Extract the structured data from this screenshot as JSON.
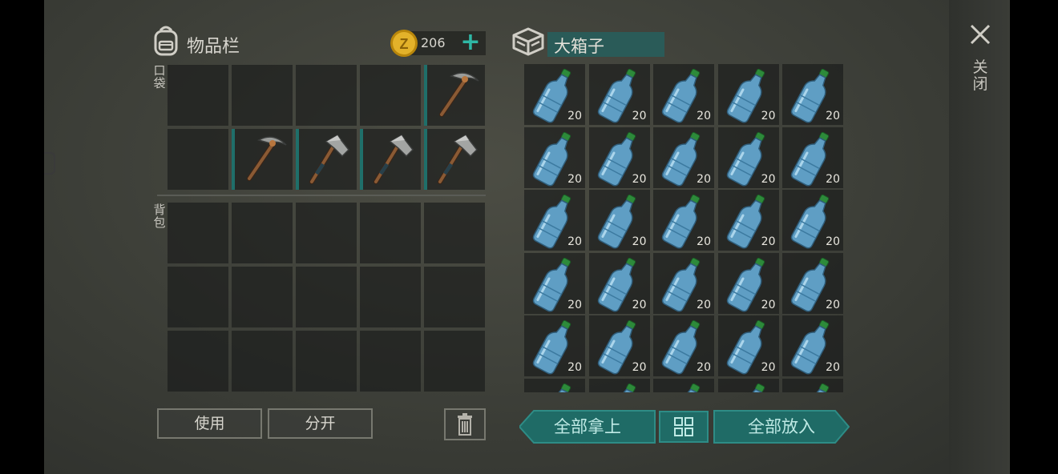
{
  "inventory": {
    "title": "物品栏",
    "coins": "206",
    "pocket_label": "口袋",
    "backpack_label": "背包",
    "pocket_slots": [
      {
        "item": null
      },
      {
        "item": null
      },
      {
        "item": null
      },
      {
        "item": null
      },
      {
        "item": "pickaxe-icon",
        "equipped": true
      },
      {
        "item": null
      },
      {
        "item": "pickaxe-icon",
        "equipped": true
      },
      {
        "item": "hatchet-icon",
        "equipped": true
      },
      {
        "item": "hatchet-icon",
        "equipped": true
      },
      {
        "item": "hatchet-icon",
        "equipped": true
      }
    ],
    "backpack_slot_count": 15,
    "use_label": "使用",
    "split_label": "分开"
  },
  "chest": {
    "title": "大箱子",
    "item": "water-bottle-icon",
    "quantity": "20",
    "visible_slot_count": 30,
    "take_all_label": "全部拿上",
    "put_all_label": "全部放入"
  },
  "close_label": "关闭",
  "colors": {
    "accent": "#2fb8a6",
    "button_teal": "#1f6b66",
    "coin": "#d9a520"
  }
}
